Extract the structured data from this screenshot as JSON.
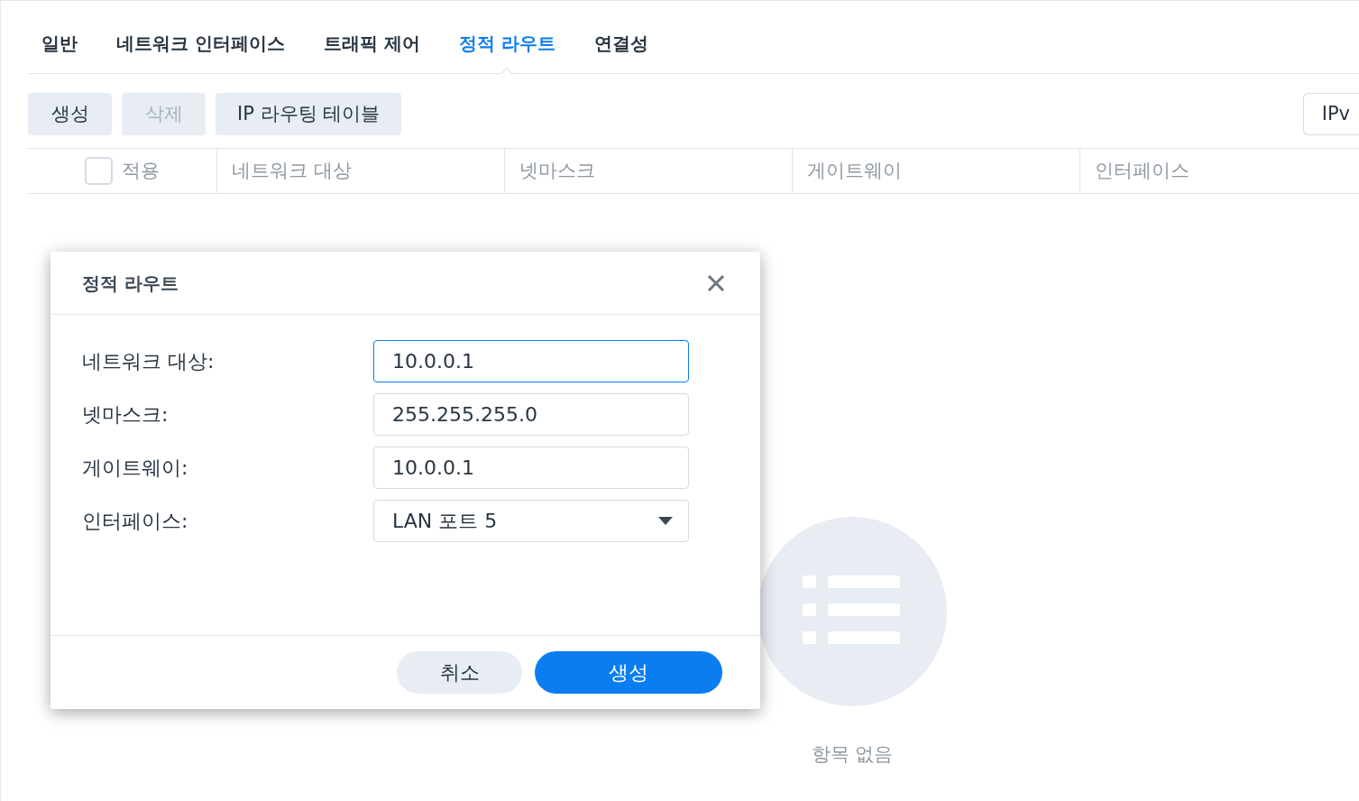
{
  "tabs": [
    {
      "label": "일반",
      "selected": false
    },
    {
      "label": "네트워크 인터페이스",
      "selected": false
    },
    {
      "label": "트래픽 제어",
      "selected": false
    },
    {
      "label": "정적 라우트",
      "selected": true
    },
    {
      "label": "연결성",
      "selected": false
    }
  ],
  "toolbar": {
    "buttons": [
      {
        "label": "생성",
        "disabled": false
      },
      {
        "label": "삭제",
        "disabled": true
      },
      {
        "label": "IP 라우팅 테이블",
        "disabled": false
      }
    ],
    "right_button": "IPv"
  },
  "table": {
    "select_all": {
      "label": "적용",
      "checked": false
    },
    "columns": [
      "네트워크 대상",
      "넷마스크",
      "게이트웨이",
      "인터페이스"
    ]
  },
  "empty_state": "항목 없음",
  "dialog": {
    "title": "정적 라우트",
    "fields": [
      {
        "kind": "text",
        "label": "네트워크 대상:",
        "value": "10.0.0.1",
        "focused": true
      },
      {
        "kind": "text",
        "label": "넷마스크:",
        "value": "255.255.255.0",
        "focused": false
      },
      {
        "kind": "text",
        "label": "게이트웨이:",
        "value": "10.0.0.1",
        "focused": false
      },
      {
        "kind": "select",
        "label": "인터페이스:",
        "value": "LAN 포트 5",
        "focused": false
      }
    ],
    "buttons": [
      {
        "kind": "secondary",
        "label": "취소"
      },
      {
        "kind": "primary",
        "label": "생성"
      }
    ]
  }
}
